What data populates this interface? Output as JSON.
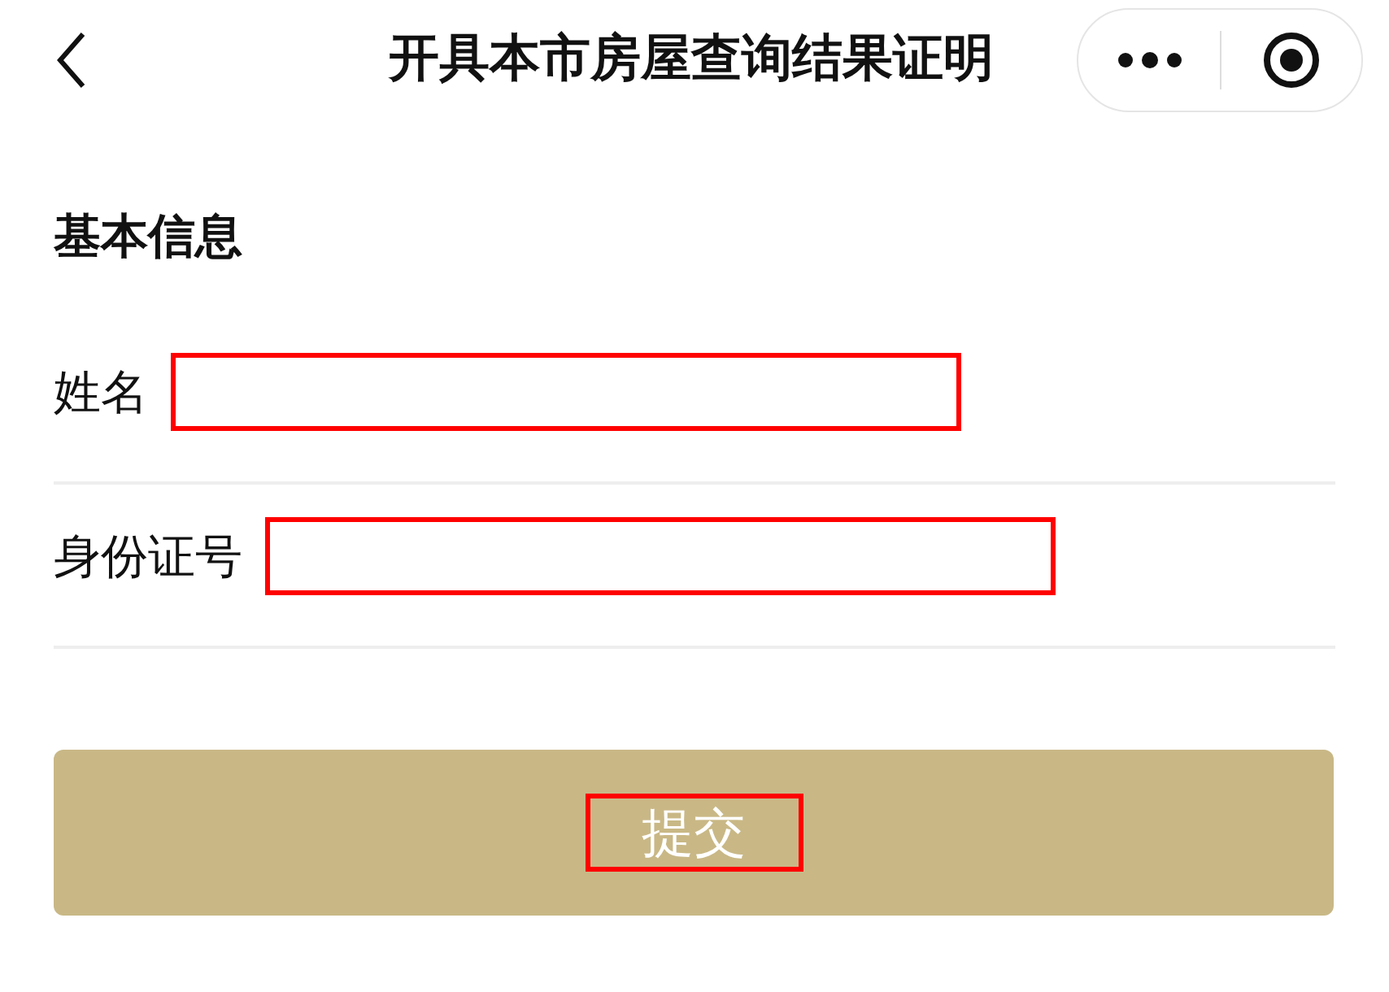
{
  "header": {
    "title": "开具本市房屋查询结果证明"
  },
  "section": {
    "title": "基本信息"
  },
  "fields": [
    {
      "label": "姓名"
    },
    {
      "label": "身份证号"
    }
  ],
  "submit": {
    "label": "提交"
  }
}
